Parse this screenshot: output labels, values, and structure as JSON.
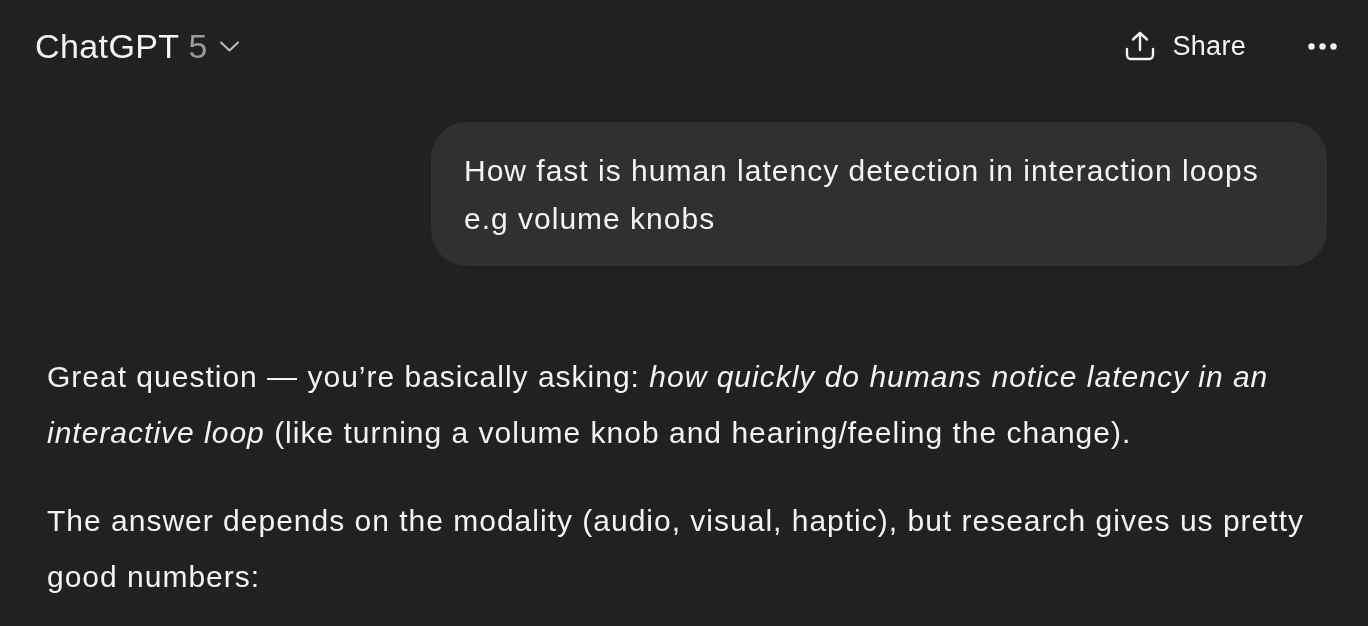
{
  "header": {
    "title": "ChatGPT",
    "model": "5",
    "share_button": "Share"
  },
  "conversation": [
    {
      "kind": "user",
      "paragraphs": [
        "How fast is human latency detection in interaction loops e.g volume knobs"
      ]
    },
    {
      "kind": "assistant",
      "paragraphs": [
        "Great question — you’re basically asking: *how quickly do humans notice latency in an interactive loop* (like turning a volume knob and hearing/feeling the change).",
        "The answer depends on the modality (audio, visual, haptic), but research gives us pretty good numbers:"
      ]
    }
  ]
}
